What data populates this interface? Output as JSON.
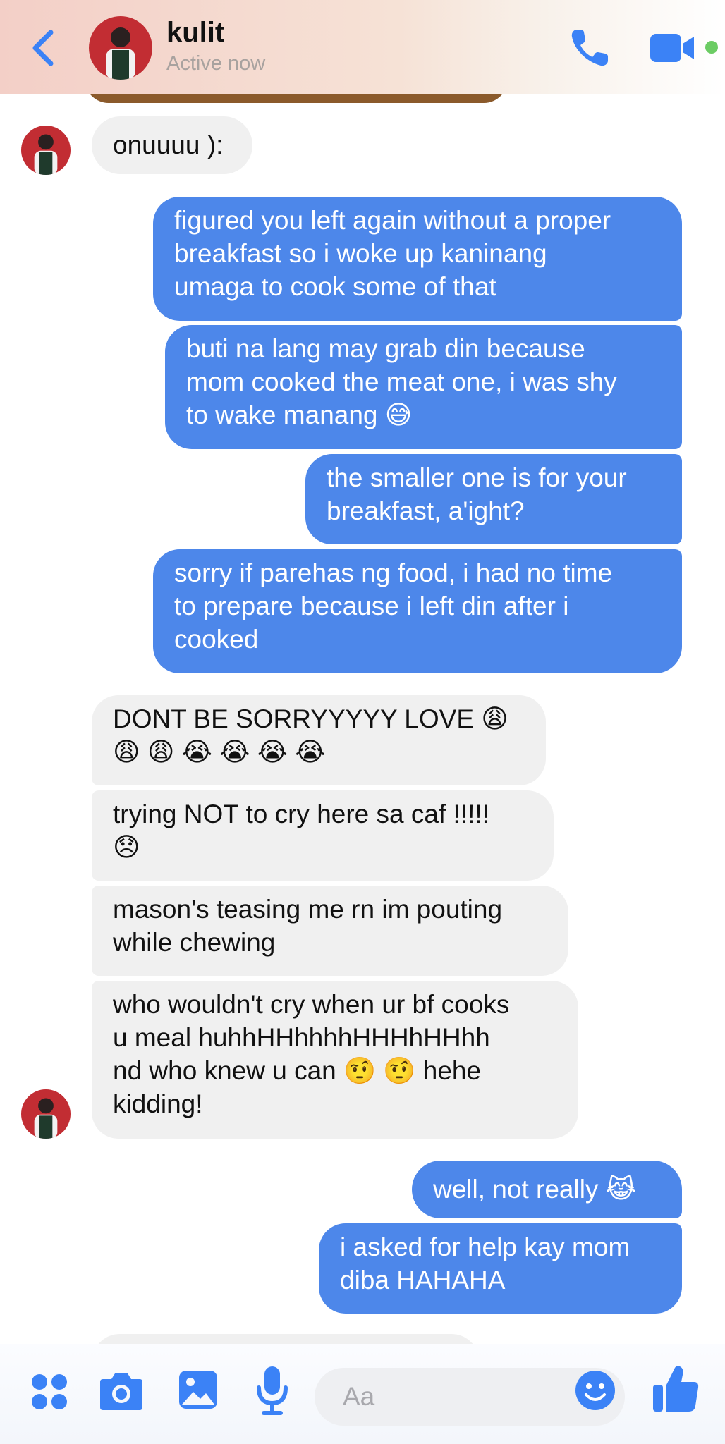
{
  "header": {
    "contact_name": "kulit",
    "status": "Active now"
  },
  "icons": {
    "back": "chevron-left-icon",
    "call": "phone-icon",
    "video": "video-camera-icon",
    "apps": "four-dots-icon",
    "camera": "camera-icon",
    "gallery": "image-icon",
    "voice": "microphone-icon",
    "emoji": "smiley-icon",
    "like": "thumbs-up-icon"
  },
  "colors": {
    "accent": "#4d87ea",
    "incoming_bubble": "#f0f0f0",
    "online": "#6ccc64"
  },
  "messages": [
    {
      "side": "incoming",
      "text": "onuuuu ):"
    },
    {
      "side": "outgoing",
      "text": "figured you left again without a proper\nbreakfast so i woke up kaninang\numaga to cook some of that"
    },
    {
      "side": "outgoing",
      "text": "buti na lang may grab din because\nmom cooked the meat one, i was shy\nto wake manang 😅"
    },
    {
      "side": "outgoing",
      "text": "the smaller one is for your\nbreakfast, a'ight?"
    },
    {
      "side": "outgoing",
      "text": "sorry if parehas ng food, i had no time\nto prepare because i left din after i\ncooked"
    },
    {
      "side": "incoming",
      "text": "DONT BE SORRYYYYY LOVE 😩\n😩 😩 😭 😭 😭 😭"
    },
    {
      "side": "incoming",
      "text": "trying NOT to cry here sa caf !!!!!\n😞"
    },
    {
      "side": "incoming",
      "text": "mason's teasing me rn im pouting\nwhile chewing"
    },
    {
      "side": "incoming",
      "text": "who wouldn't cry when ur bf cooks\nu meal huhhHHhhhhHHHhHHhh\nnd who knew u can 🤨 🤨 hehe\nkidding!"
    },
    {
      "side": "outgoing",
      "text": "well, not really 😹"
    },
    {
      "side": "outgoing",
      "text": "i asked for help kay mom\ndiba HAHAHA"
    }
  ],
  "composer": {
    "placeholder": "Aa"
  }
}
